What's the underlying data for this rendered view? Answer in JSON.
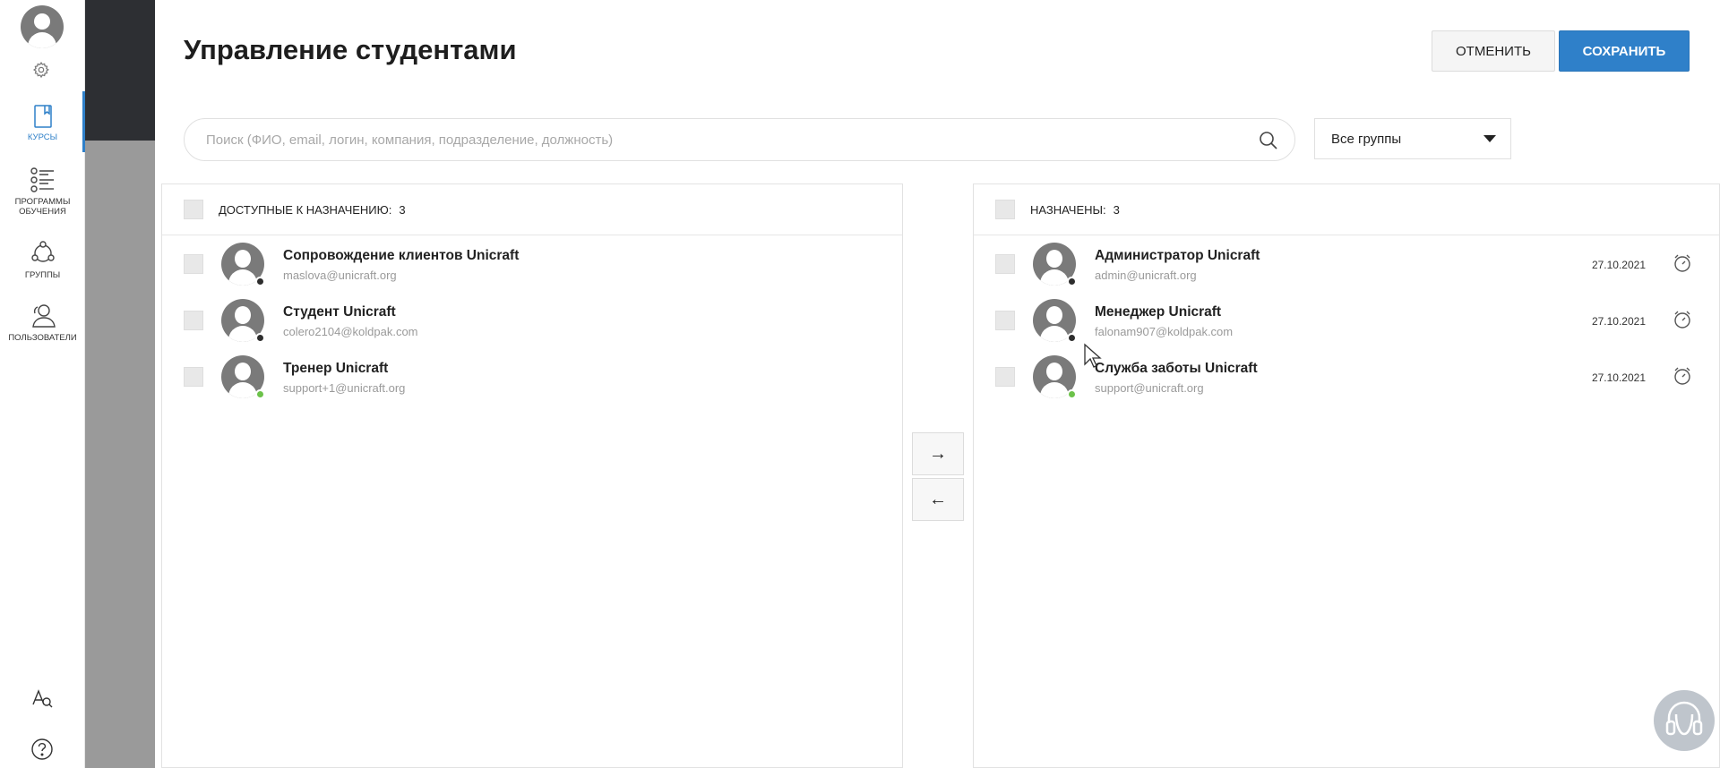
{
  "sidebar": {
    "items": [
      {
        "label": "КУРСЫ",
        "icon": "book-icon",
        "active": true
      },
      {
        "label": "ПРОГРАММЫ ОБУЧЕНИЯ",
        "icon": "list-icon",
        "active": false
      },
      {
        "label": "ГРУППЫ",
        "icon": "groups-icon",
        "active": false
      },
      {
        "label": "ПОЛЬЗОВАТЕЛИ",
        "icon": "users-icon",
        "active": false
      }
    ]
  },
  "header": {
    "title": "Управление студентами",
    "cancel_label": "ОТМЕНИТЬ",
    "save_label": "СОХРАНИТЬ"
  },
  "search": {
    "placeholder": "Поиск (ФИО, email, логин, компания, подразделение, должность)",
    "value": ""
  },
  "group_filter": {
    "selected": "Все группы"
  },
  "available": {
    "header": "ДОСТУПНЫЕ К НАЗНАЧЕНИЮ:",
    "count": "3",
    "users": [
      {
        "name": "Сопровождение клиентов Unicraft",
        "email": "maslova@unicraft.org",
        "status": "offline"
      },
      {
        "name": "Студент Unicraft",
        "email": "colero2104@koldpak.com",
        "status": "offline"
      },
      {
        "name": "Тренер Unicraft",
        "email": "support+1@unicraft.org",
        "status": "online"
      }
    ]
  },
  "assigned": {
    "header": "НАЗНАЧЕНЫ:",
    "count": "3",
    "users": [
      {
        "name": "Администратор Unicraft",
        "email": "admin@unicraft.org",
        "date": "27.10.2021",
        "status": "offline"
      },
      {
        "name": "Менеджер Unicraft",
        "email": "falonam907@koldpak.com",
        "date": "27.10.2021",
        "status": "offline"
      },
      {
        "name": "Служба заботы Unicraft",
        "email": "support@unicraft.org",
        "date": "27.10.2021",
        "status": "online"
      }
    ]
  },
  "transfer": {
    "right": "→",
    "left": "←"
  },
  "colors": {
    "accent": "#2f80c9",
    "online": "#6cc24a",
    "offline": "#2d2d2d"
  }
}
